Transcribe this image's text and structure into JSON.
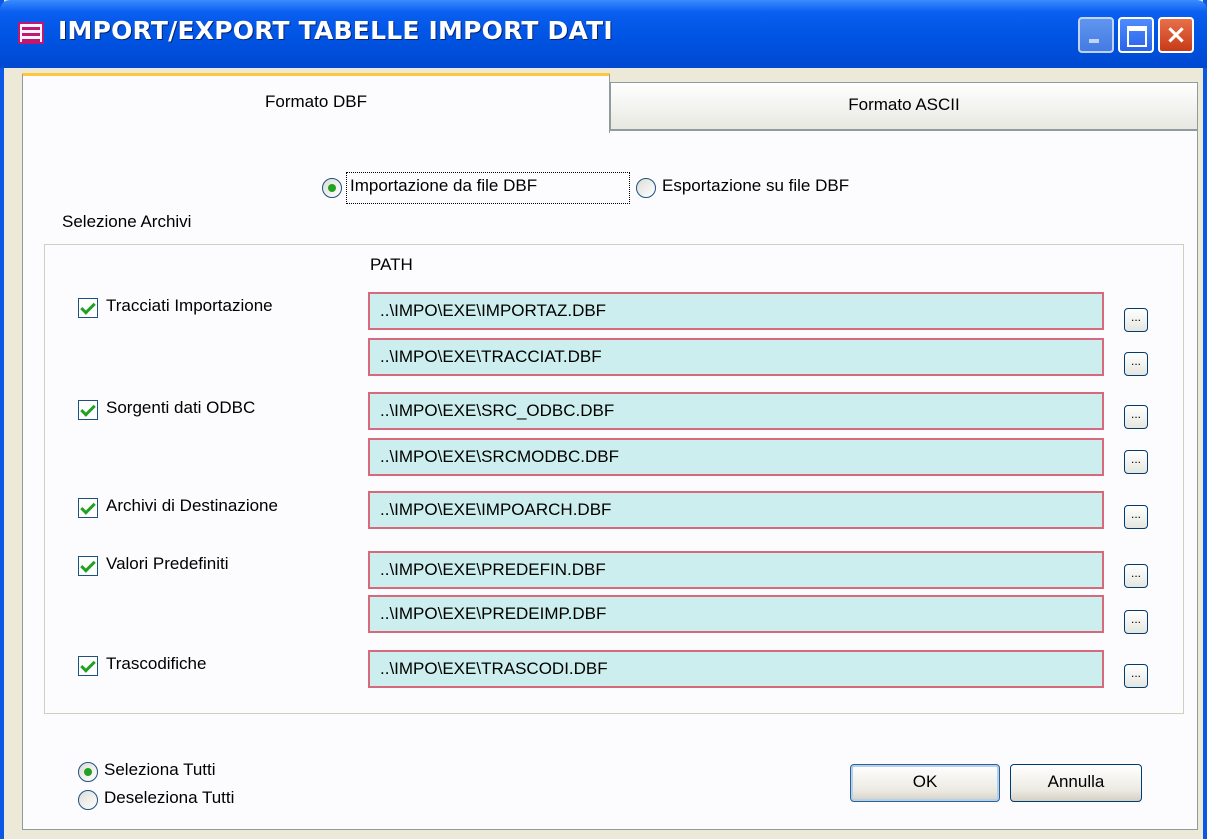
{
  "window": {
    "title": "IMPORT/EXPORT TABELLE IMPORT DATI",
    "icon": "table-icon",
    "controls": {
      "minimize": "minimize",
      "maximize": "maximize",
      "close": "×"
    }
  },
  "tabs": [
    {
      "label": "Formato DBF",
      "active": true
    },
    {
      "label": "Formato ASCII",
      "active": false
    }
  ],
  "mode": {
    "options": [
      {
        "label": "Importazione da file DBF",
        "selected": true
      },
      {
        "label": "Esportazione su file DBF",
        "selected": false
      }
    ]
  },
  "selezione": {
    "label": "Selezione Archivi",
    "path_header": "PATH",
    "items": [
      {
        "label": "Tracciati Importazione",
        "checked": true,
        "paths": [
          "..\\IMPO\\EXE\\IMPORTAZ.DBF",
          "..\\IMPO\\EXE\\TRACCIAT.DBF"
        ]
      },
      {
        "label": "Sorgenti dati ODBC",
        "checked": true,
        "paths": [
          "..\\IMPO\\EXE\\SRC_ODBC.DBF",
          "..\\IMPO\\EXE\\SRCMODBC.DBF"
        ]
      },
      {
        "label": "Archivi di Destinazione",
        "checked": true,
        "paths": [
          "..\\IMPO\\EXE\\IMPOARCH.DBF"
        ]
      },
      {
        "label": "Valori Predefiniti",
        "checked": true,
        "paths": [
          "..\\IMPO\\EXE\\PREDEFIN.DBF",
          "..\\IMPO\\EXE\\PREDEIMP.DBF"
        ]
      },
      {
        "label": "Trascodifiche",
        "checked": true,
        "paths": [
          "..\\IMPO\\EXE\\TRASCODI.DBF"
        ]
      }
    ],
    "browse_label": "..."
  },
  "select_all": {
    "options": [
      {
        "label": "Seleziona Tutti",
        "selected": true
      },
      {
        "label": "Deseleziona Tutti",
        "selected": false
      }
    ]
  },
  "buttons": {
    "ok": "OK",
    "cancel": "Annulla"
  },
  "colors": {
    "titlebar": "#0054e3",
    "field_bg": "#cceeee",
    "field_border": "#d66a7a",
    "check_green": "#21a121",
    "tab_highlight": "#ffc83c"
  }
}
